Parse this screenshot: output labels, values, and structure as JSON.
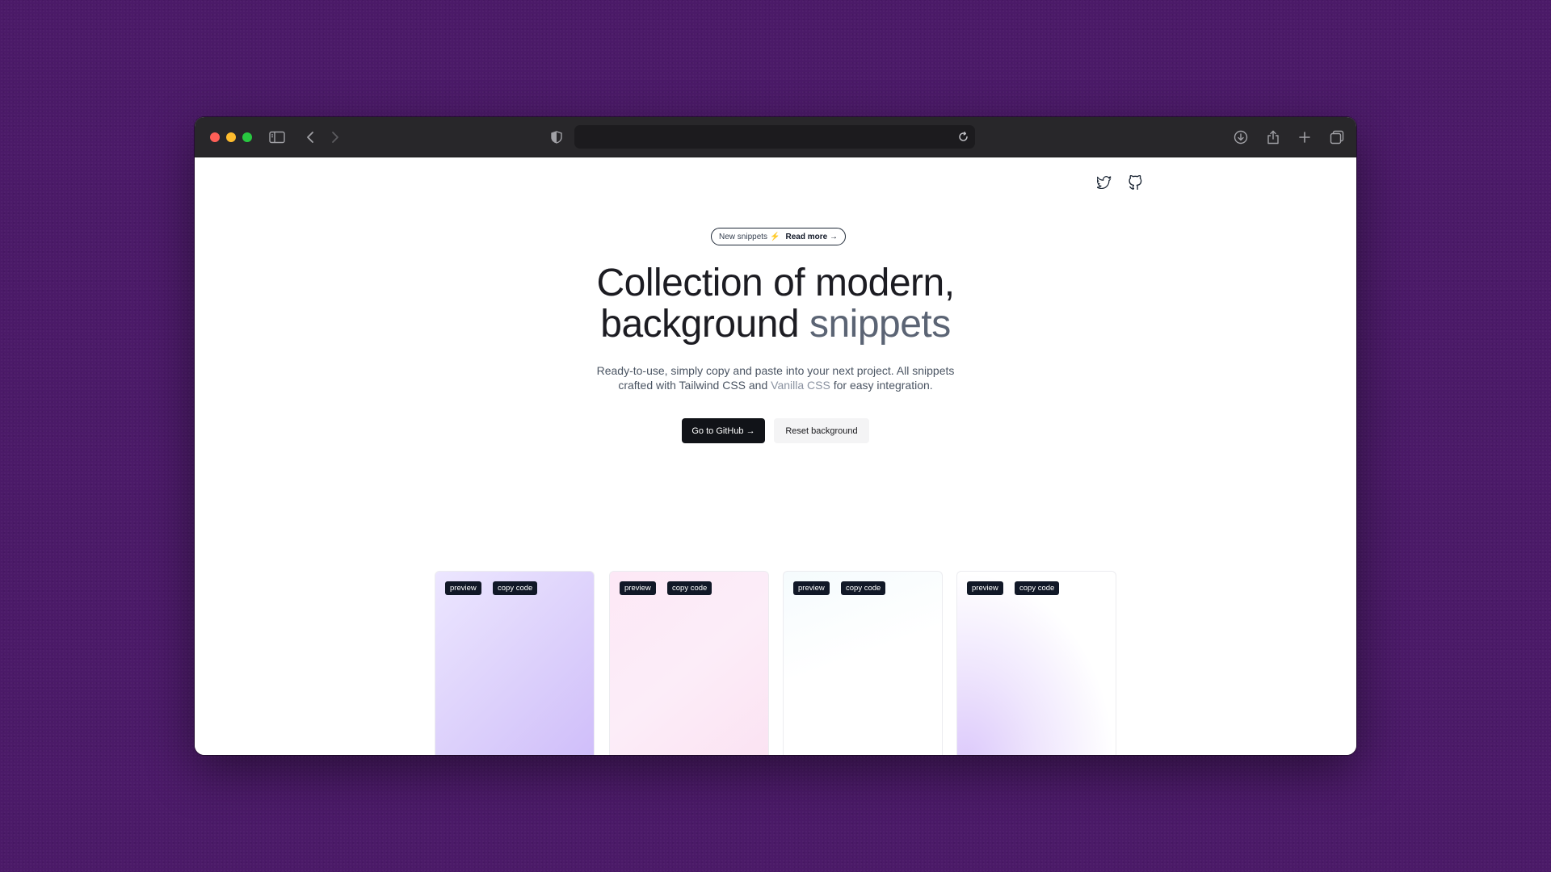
{
  "colors": {
    "desktop": "#4b1a68",
    "toolbar": "#28272a",
    "dark_button": "#111318",
    "accent_text": "#5b6474"
  },
  "toolbar": {
    "icons": [
      "sidebar-icon",
      "back-arrow-icon",
      "forward-arrow-icon",
      "shield-icon",
      "reload-icon",
      "download-icon",
      "share-icon",
      "new-tab-icon",
      "tabs-overview-icon"
    ],
    "address_value": ""
  },
  "header": {
    "social_icons": [
      "twitter-icon",
      "github-icon"
    ]
  },
  "announcement": {
    "label": "New snippets",
    "emoji": "⚡",
    "link": "Read more →"
  },
  "hero": {
    "title_line1": "Collection of modern,",
    "title_line2_main": "background",
    "title_line2_accent": "snippets",
    "subtitle_line1": "Ready-to-use, simply copy and paste into your next project. All snippets",
    "subtitle_line2_pre": "crafted with Tailwind CSS and",
    "subtitle_line2_link": "Vanilla CSS",
    "subtitle_line2_post": "for easy integration."
  },
  "actions": {
    "primary": "Go to GitHub →",
    "secondary": "Reset background"
  },
  "cards": [
    {
      "preview": "preview",
      "copy": "copy code"
    },
    {
      "preview": "preview",
      "copy": "copy code"
    },
    {
      "preview": "preview",
      "copy": "copy code"
    },
    {
      "preview": "preview",
      "copy": "copy code"
    }
  ]
}
